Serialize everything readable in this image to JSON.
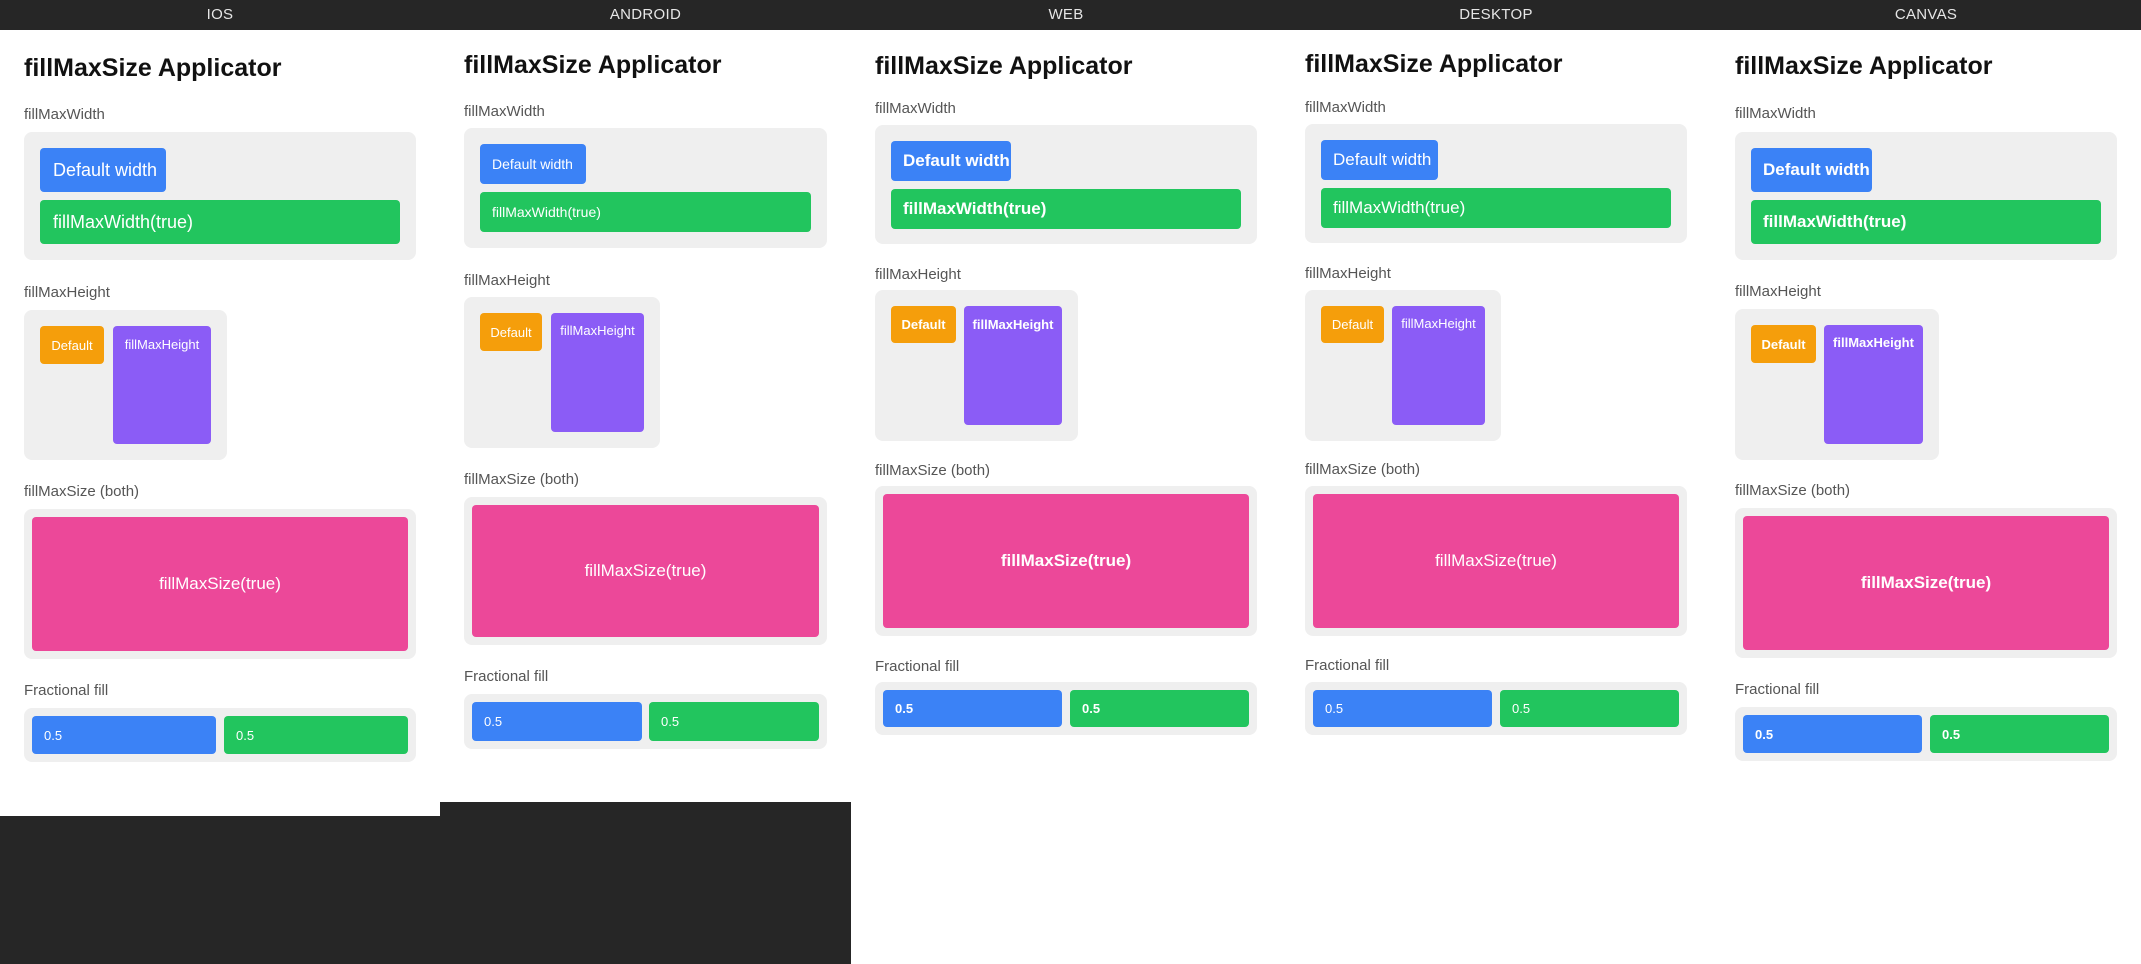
{
  "columns": [
    {
      "platform": "IOS",
      "title": "fillMaxSize Applicator",
      "sections": {
        "width_label": "fillMaxWidth",
        "width_default": "Default width",
        "width_fill": "fillMaxWidth(true)",
        "height_label": "fillMaxHeight",
        "height_default": "Default",
        "height_fill": "fillMaxHeight",
        "size_label": "fillMaxSize (both)",
        "size_fill": "fillMaxSize(true)",
        "fraction_label": "Fractional fill",
        "fraction_a": "0.5",
        "fraction_b": "0.5"
      }
    },
    {
      "platform": "ANDROID",
      "title": "fillMaxSize Applicator",
      "sections": {
        "width_label": "fillMaxWidth",
        "width_default": "Default width",
        "width_fill": "fillMaxWidth(true)",
        "height_label": "fillMaxHeight",
        "height_default": "Default",
        "height_fill": "fillMaxHeight",
        "size_label": "fillMaxSize (both)",
        "size_fill": "fillMaxSize(true)",
        "fraction_label": "Fractional fill",
        "fraction_a": "0.5",
        "fraction_b": "0.5"
      }
    },
    {
      "platform": "WEB",
      "title": "fillMaxSize Applicator",
      "sections": {
        "width_label": "fillMaxWidth",
        "width_default": "Default width",
        "width_fill": "fillMaxWidth(true)",
        "height_label": "fillMaxHeight",
        "height_default": "Default",
        "height_fill": "fillMaxHeight",
        "size_label": "fillMaxSize (both)",
        "size_fill": "fillMaxSize(true)",
        "fraction_label": "Fractional fill",
        "fraction_a": "0.5",
        "fraction_b": "0.5"
      }
    },
    {
      "platform": "DESKTOP",
      "title": "fillMaxSize Applicator",
      "sections": {
        "width_label": "fillMaxWidth",
        "width_default": "Default width",
        "width_fill": "fillMaxWidth(true)",
        "height_label": "fillMaxHeight",
        "height_default": "Default",
        "height_fill": "fillMaxHeight",
        "size_label": "fillMaxSize (both)",
        "size_fill": "fillMaxSize(true)",
        "fraction_label": "Fractional fill",
        "fraction_a": "0.5",
        "fraction_b": "0.5"
      }
    },
    {
      "platform": "CANVAS",
      "title": "fillMaxSize Applicator",
      "sections": {
        "width_label": "fillMaxWidth",
        "width_default": "Default width",
        "width_fill": "fillMaxWidth(true)",
        "height_label": "fillMaxHeight",
        "height_default": "Default",
        "height_fill": "fillMaxHeight",
        "size_label": "fillMaxSize (both)",
        "size_fill": "fillMaxSize(true)",
        "fraction_label": "Fractional fill",
        "fraction_a": "0.5",
        "fraction_b": "0.5"
      }
    }
  ],
  "colors": {
    "header_bg": "#262626",
    "panel_bg": "#ffffff",
    "section_bg": "#efefef",
    "blue": "#3b82f6",
    "green": "#22c55e",
    "orange": "#f59e0b",
    "purple": "#8b5cf6",
    "pink": "#ec4899"
  }
}
